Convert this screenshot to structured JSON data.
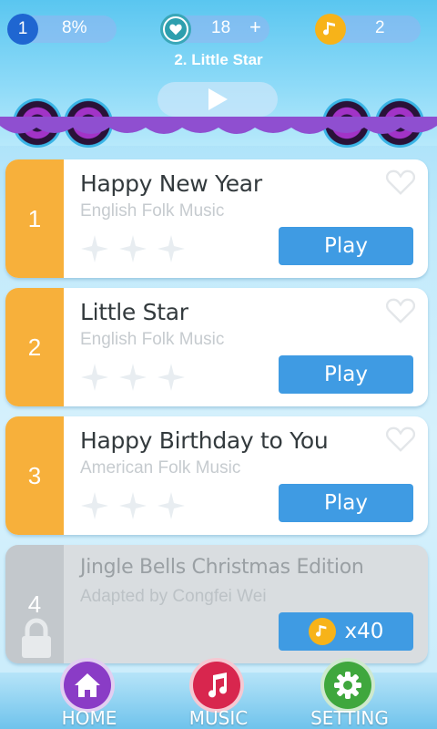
{
  "header": {
    "level": "1",
    "progress_text": "8%",
    "lives": "18",
    "add_lives": "+",
    "coins": "2",
    "current_song": "2. Little Star"
  },
  "songs": [
    {
      "number": "1",
      "title": "Happy New Year",
      "subtitle": "English Folk Music",
      "action": "Play",
      "stars_earned": 0,
      "locked": false
    },
    {
      "number": "2",
      "title": "Little Star",
      "subtitle": "English Folk Music",
      "action": "Play",
      "stars_earned": 0,
      "locked": false
    },
    {
      "number": "3",
      "title": "Happy Birthday to You",
      "subtitle": "American Folk Music",
      "action": "Play",
      "stars_earned": 0,
      "locked": true
    },
    {
      "number": "4",
      "title": "Jingle Bells Christmas Edition",
      "subtitle": "Adapted by Congfei Wei",
      "action": "x40",
      "stars_earned": 0,
      "locked": true
    }
  ],
  "nav": {
    "home": "HOME",
    "music": "MUSIC",
    "setting": "SETTING"
  },
  "colors": {
    "accent_blue": "#3f9be3",
    "number_strip": "#f7b03b",
    "coin": "#f7b319"
  }
}
